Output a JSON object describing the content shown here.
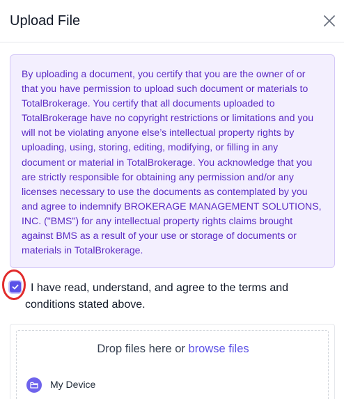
{
  "modal": {
    "title": "Upload File",
    "close_icon": "close-icon"
  },
  "notice": {
    "text": "By uploading a document, you certify that you are the owner of or that you have permission to upload such document or materials to TotalBrokerage. You certify that all documents uploaded to TotalBrokerage have no copyright restrictions or limitations and you will not be violating anyone else’s intellectual property rights by uploading, using, storing, editing, modifying, or filling in any document or material in TotalBrokerage. You acknowledge that you are strictly responsible for obtaining any permission and/or any licenses necessary to use the documents as contemplated by you and agree to indemnify BROKERAGE MANAGEMENT SOLUTIONS, INC. (\"BMS\") for any intellectual property rights claims brought against BMS as a result of your use or storage of documents or materials in TotalBrokerage."
  },
  "agreement": {
    "checked": true,
    "label": "I have read, understand, and agree to the terms and conditions stated above."
  },
  "dropzone": {
    "prompt": "Drop files here or",
    "browse_label": "browse files",
    "source_label": "My Device",
    "source_icon": "folder-icon"
  },
  "colors": {
    "accent": "#5b51e6",
    "notice_bg": "#f3effe",
    "notice_text": "#5b2bc4",
    "annotation_red": "#e12b2b"
  }
}
